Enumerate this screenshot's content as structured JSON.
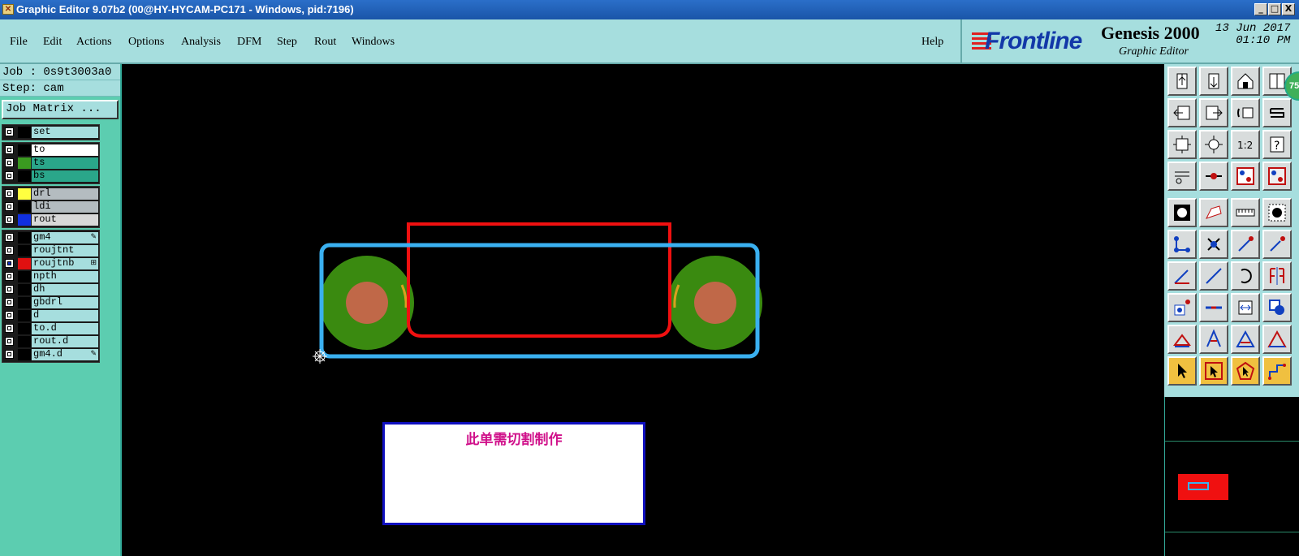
{
  "window": {
    "title": "Graphic Editor 9.07b2 (00@HY-HYCAM-PC171 - Windows, pid:7196)",
    "minimize": "_",
    "maximize": "□",
    "close": "X"
  },
  "menu": {
    "items": [
      "File",
      "Edit",
      "Actions",
      "Options",
      "Analysis",
      "DFM",
      "Step",
      "Rout",
      "Windows"
    ],
    "help": "Help"
  },
  "logo": {
    "brand": "Frontline",
    "product": "Genesis 2000",
    "subtitle": "Graphic Editor",
    "date": "13 Jun 2017",
    "time": "01:10 PM"
  },
  "job": {
    "job_label": "Job : 0s9t3003a0",
    "step_label": "Step: cam",
    "job_matrix_button": "Job Matrix ..."
  },
  "layers": [
    {
      "group": 1,
      "name": "set",
      "swatch": "#000000",
      "bg": "#a6dede"
    },
    {
      "group": 2,
      "name": "to",
      "swatch": "#000000",
      "bg": "#ffffff"
    },
    {
      "group": 2,
      "name": "ts",
      "swatch": "#3a9a20",
      "bg": "#2aa68a"
    },
    {
      "group": 2,
      "name": "bs",
      "swatch": "#000000",
      "bg": "#2aa68a"
    },
    {
      "group": 3,
      "name": "drl",
      "swatch": "#ffff40",
      "bg": "#b4bcc0"
    },
    {
      "group": 3,
      "name": "ldi",
      "swatch": "#000000",
      "bg": "#b4bcc0"
    },
    {
      "group": 3,
      "name": "rout",
      "swatch": "#1030e0",
      "bg": "#d8d8d8"
    },
    {
      "group": 4,
      "name": "gm4",
      "swatch": "#000000",
      "bg": "#a6dede",
      "mark": "✎"
    },
    {
      "group": 4,
      "name": "roujtnt",
      "swatch": "#000000",
      "bg": "#a6dede"
    },
    {
      "group": 4,
      "name": "roujtnb",
      "swatch": "#e01010",
      "bg": "#a6dede",
      "mark": "⊞",
      "checked": true
    },
    {
      "group": 4,
      "name": "npth",
      "swatch": "#000000",
      "bg": "#a6dede"
    },
    {
      "group": 4,
      "name": "dh",
      "swatch": "#000000",
      "bg": "#a6dede"
    },
    {
      "group": 4,
      "name": "gbdrl",
      "swatch": "#000000",
      "bg": "#a6dede"
    },
    {
      "group": 4,
      "name": "d",
      "swatch": "#000000",
      "bg": "#a6dede"
    },
    {
      "group": 4,
      "name": "to.d",
      "swatch": "#000000",
      "bg": "#a6dede"
    },
    {
      "group": 4,
      "name": "rout.d",
      "swatch": "#000000",
      "bg": "#a6dede"
    },
    {
      "group": 4,
      "name": "gm4.d",
      "swatch": "#000000",
      "bg": "#a6dede",
      "mark": "✎"
    }
  ],
  "canvas": {
    "note_text": "此单需切割制作",
    "colors": {
      "outline": "#3ab0f0",
      "cutout": "#f01010",
      "pad": "#3a8a10",
      "drill": "#c06848",
      "note_border": "#1010c0",
      "note_text": "#d0108a"
    }
  },
  "toolbox": {
    "badge": "75",
    "tools": [
      "zoom-home-icon",
      "zoom-back-icon",
      "home-icon",
      "window-icon",
      "pan-left-icon",
      "pan-right-icon",
      "undo-redo-icon",
      "redraw-icon",
      "zoom-fit-icon",
      "zoom-center-icon",
      "one-to-two-icon",
      "help-icon",
      "snap-icon",
      "measure-dot-icon",
      "layer-red-icon",
      "layer-gray-icon",
      "add-pad-icon",
      "add-line-icon",
      "ruler-icon",
      "dot-select-icon",
      "move-node-icon",
      "delete-node-icon",
      "connect-point-icon",
      "point-arrow-icon",
      "draw-arc-icon",
      "draw-line-icon",
      "rotate-icon",
      "mirror-icon",
      "move-pad-icon",
      "break-line-icon",
      "resize-icon",
      "copy-shape-icon",
      "triangle-small-icon",
      "triangle-tall-icon",
      "triangle-wide-icon",
      "triangle-up-icon",
      "select-arrow-icon",
      "select-box-icon",
      "select-polygon-icon",
      "route-icon"
    ]
  }
}
